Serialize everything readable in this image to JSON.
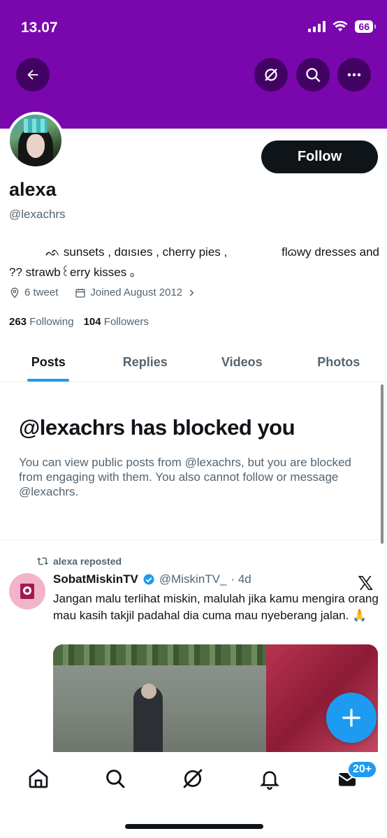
{
  "status_bar": {
    "time": "13.07",
    "battery": "66"
  },
  "colors": {
    "banner": "#7a06ad",
    "accent": "#1d9bf0",
    "text": "#0f1419",
    "muted": "#536471"
  },
  "header_icons": [
    "back-arrow-icon",
    "grok-icon",
    "search-icon",
    "more-icon"
  ],
  "profile": {
    "name": "alexa",
    "handle": "@lexachrs",
    "follow_label": "Follow",
    "bio_line1_a": "ᨒ sunsets , dɑısıes , cherry pies ,",
    "bio_line1_b": "flɷwy dresses and",
    "bio_line2": "?? strawb꒰erry kisses ｡",
    "location": "6 tweet",
    "joined": "Joined August 2012",
    "following_count": "263",
    "following_label": "Following",
    "followers_count": "104",
    "followers_label": "Followers"
  },
  "tabs": [
    {
      "label": "Posts",
      "active": true
    },
    {
      "label": "Replies",
      "active": false
    },
    {
      "label": "Videos",
      "active": false
    },
    {
      "label": "Photos",
      "active": false
    }
  ],
  "blocked": {
    "title": "@lexachrs has blocked you",
    "description": "You can view public posts from @lexachrs, but you are blocked from engaging with them. You also cannot follow or message @lexachrs."
  },
  "tweet": {
    "repost_label": "alexa reposted",
    "display_name": "SobatMiskinTV",
    "handle": "@MiskinTV_",
    "time": "· 4d",
    "text": "Jangan malu terlihat miskin, malulah jika kamu mengira orang mau kasih takjil padahal dia cuma mau nyeberang jalan. 🙏",
    "logo": "𝕏"
  },
  "bottom_nav": {
    "items": [
      "home-icon",
      "search-icon",
      "grok-icon",
      "notifications-icon",
      "messages-icon"
    ],
    "messages_badge": "20+"
  }
}
